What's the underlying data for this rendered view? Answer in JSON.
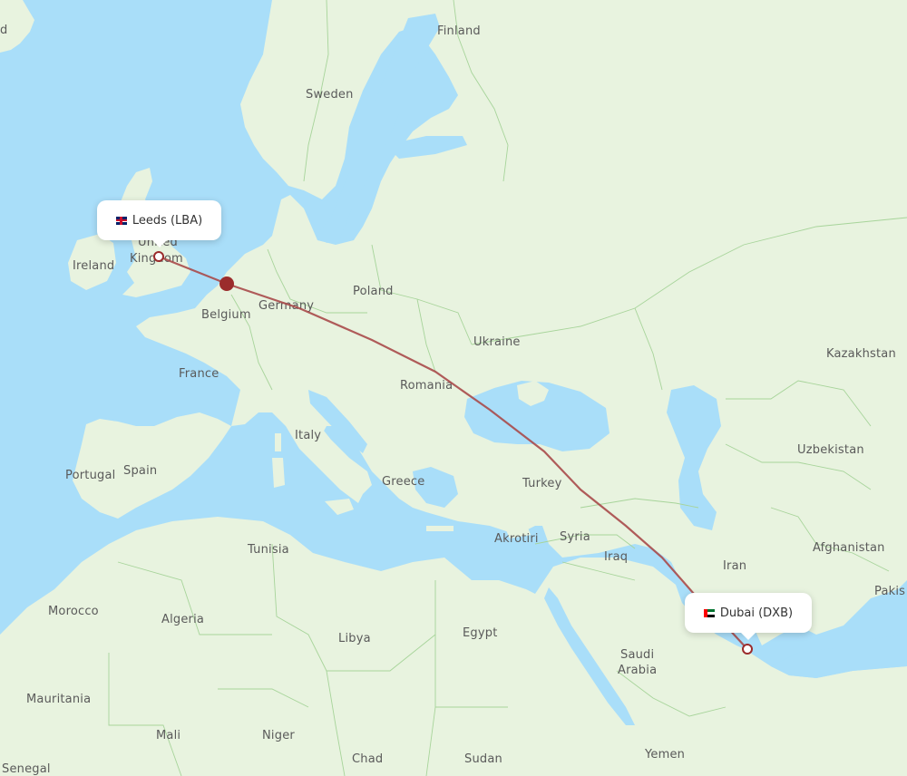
{
  "map": {
    "colors": {
      "sea": "#a9def9",
      "land": "#e8f3df",
      "land_alt": "#dfedd3",
      "border": "#a7d49a",
      "route": "#a94a4a",
      "marker": "#9b2c2c",
      "label": "#5a5a5a"
    },
    "route": {
      "origin": {
        "city": "Leeds",
        "code": "LBA",
        "label": "Leeds (LBA)",
        "flag": "uk-flag"
      },
      "destination": {
        "city": "Dubai",
        "code": "DXB",
        "label": "Dubai (DXB)",
        "flag": "uae-flag"
      },
      "waypoint": "amsterdam-marker"
    },
    "labels": [
      {
        "id": "finland",
        "text": "Finland"
      },
      {
        "id": "sweden",
        "text": "Sweden"
      },
      {
        "id": "iceland-partial",
        "text": "d"
      },
      {
        "id": "united-kingdom-1",
        "text": "United"
      },
      {
        "id": "united-kingdom-2",
        "text": "Kingdom"
      },
      {
        "id": "ireland",
        "text": "Ireland"
      },
      {
        "id": "belgium",
        "text": "Belgium"
      },
      {
        "id": "germany",
        "text": "Germany"
      },
      {
        "id": "poland",
        "text": "Poland"
      },
      {
        "id": "ukraine",
        "text": "Ukraine"
      },
      {
        "id": "kazakhstan",
        "text": "Kazakhstan"
      },
      {
        "id": "france",
        "text": "France"
      },
      {
        "id": "romania",
        "text": "Romania"
      },
      {
        "id": "italy",
        "text": "Italy"
      },
      {
        "id": "uzbekistan",
        "text": "Uzbekistan"
      },
      {
        "id": "portugal",
        "text": "Portugal"
      },
      {
        "id": "spain",
        "text": "Spain"
      },
      {
        "id": "greece",
        "text": "Greece"
      },
      {
        "id": "turkey",
        "text": "Turkey"
      },
      {
        "id": "akrotiri",
        "text": "Akrotiri"
      },
      {
        "id": "syria",
        "text": "Syria"
      },
      {
        "id": "tunisia",
        "text": "Tunisia"
      },
      {
        "id": "iraq",
        "text": "Iraq"
      },
      {
        "id": "iran",
        "text": "Iran"
      },
      {
        "id": "afghanistan",
        "text": "Afghanistan"
      },
      {
        "id": "pakistan-partial",
        "text": "Pakis"
      },
      {
        "id": "morocco",
        "text": "Morocco"
      },
      {
        "id": "algeria",
        "text": "Algeria"
      },
      {
        "id": "libya",
        "text": "Libya"
      },
      {
        "id": "egypt",
        "text": "Egypt"
      },
      {
        "id": "saudi-arabia-1",
        "text": "Saudi"
      },
      {
        "id": "saudi-arabia-2",
        "text": "Arabia"
      },
      {
        "id": "mauritania",
        "text": "Mauritania"
      },
      {
        "id": "mali",
        "text": "Mali"
      },
      {
        "id": "niger",
        "text": "Niger"
      },
      {
        "id": "chad",
        "text": "Chad"
      },
      {
        "id": "sudan",
        "text": "Sudan"
      },
      {
        "id": "yemen",
        "text": "Yemen"
      },
      {
        "id": "senegal",
        "text": "Senegal"
      }
    ]
  }
}
